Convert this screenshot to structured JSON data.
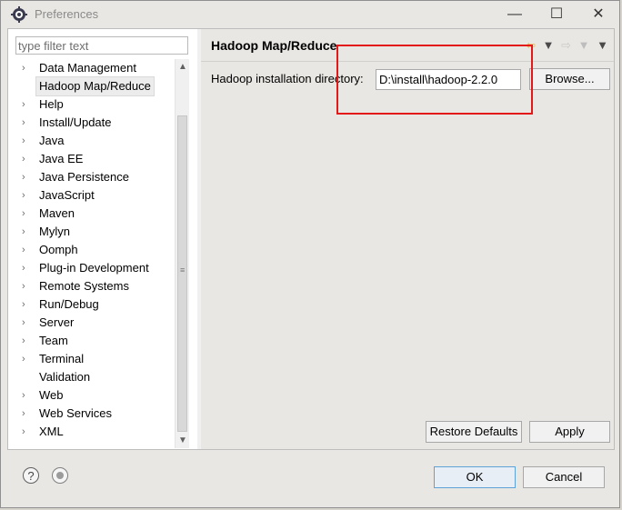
{
  "window": {
    "title": "Preferences"
  },
  "filter": {
    "placeholder": "type filter text"
  },
  "tree": {
    "items": [
      {
        "label": "Data Management",
        "chevron": true
      },
      {
        "label": "Hadoop Map/Reduce",
        "chevron": false,
        "selected": true
      },
      {
        "label": "Help",
        "chevron": true
      },
      {
        "label": "Install/Update",
        "chevron": true
      },
      {
        "label": "Java",
        "chevron": true
      },
      {
        "label": "Java EE",
        "chevron": true
      },
      {
        "label": "Java Persistence",
        "chevron": true
      },
      {
        "label": "JavaScript",
        "chevron": true
      },
      {
        "label": "Maven",
        "chevron": true
      },
      {
        "label": "Mylyn",
        "chevron": true
      },
      {
        "label": "Oomph",
        "chevron": true
      },
      {
        "label": "Plug-in Development",
        "chevron": true
      },
      {
        "label": "Remote Systems",
        "chevron": true
      },
      {
        "label": "Run/Debug",
        "chevron": true
      },
      {
        "label": "Server",
        "chevron": true
      },
      {
        "label": "Team",
        "chevron": true
      },
      {
        "label": "Terminal",
        "chevron": true
      },
      {
        "label": "Validation",
        "chevron": false
      },
      {
        "label": "Web",
        "chevron": true
      },
      {
        "label": "Web Services",
        "chevron": true
      },
      {
        "label": "XML",
        "chevron": true
      }
    ]
  },
  "page": {
    "title": "Hadoop Map/Reduce",
    "field_label": "Hadoop installation directory:",
    "field_value": "D:\\install\\hadoop-2.2.0",
    "browse_label": "Browse...",
    "restore_label": "Restore Defaults",
    "apply_label": "Apply"
  },
  "footer": {
    "ok_label": "OK",
    "cancel_label": "Cancel"
  },
  "icons": {
    "window": "eclipse-gear-icon",
    "back": "back-arrow-icon",
    "forward": "forward-arrow-icon",
    "help": "help-icon",
    "record": "record-icon"
  },
  "colors": {
    "highlight": "#e31818",
    "selection": "#ececec",
    "ok_border": "#5ea2d8"
  }
}
